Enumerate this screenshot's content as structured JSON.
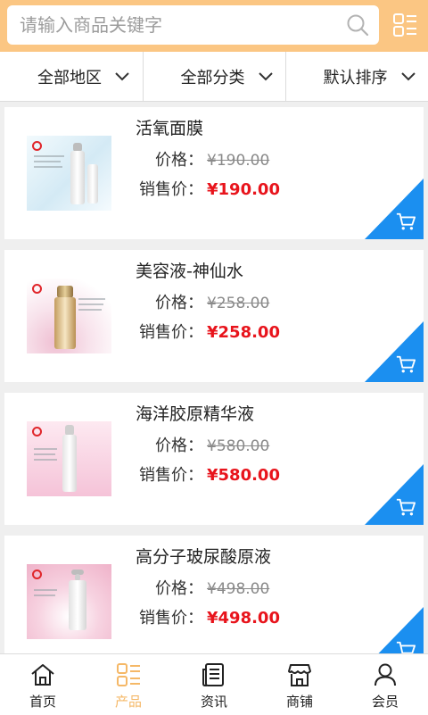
{
  "header": {
    "search_placeholder": "请输入商品关键字",
    "search_icon": "search-icon",
    "menu_icon": "grid-list-icon"
  },
  "filters": [
    {
      "label": "全部地区",
      "icon": "chevron-down-icon"
    },
    {
      "label": "全部分类",
      "icon": "chevron-down-icon"
    },
    {
      "label": "默认排序",
      "icon": "chevron-down-icon"
    }
  ],
  "products": [
    {
      "title": "活氧面膜",
      "price_label": "价格：",
      "price": "¥190.00",
      "sale_label": "销售价：",
      "sale_price": "¥190.00"
    },
    {
      "title": "美容液-神仙水",
      "price_label": "价格：",
      "price": "¥258.00",
      "sale_label": "销售价：",
      "sale_price": "¥258.00"
    },
    {
      "title": "海洋胶原精华液",
      "price_label": "价格：",
      "price": "¥580.00",
      "sale_label": "销售价：",
      "sale_price": "¥580.00"
    },
    {
      "title": "高分子玻尿酸原液",
      "price_label": "价格：",
      "price": "¥498.00",
      "sale_label": "销售价：",
      "sale_price": "¥498.00"
    }
  ],
  "product_action_icon": "cart-icon",
  "nav": [
    {
      "label": "首页",
      "icon": "home-icon",
      "active": false
    },
    {
      "label": "产品",
      "icon": "product-grid-icon",
      "active": true
    },
    {
      "label": "资讯",
      "icon": "news-icon",
      "active": false
    },
    {
      "label": "商铺",
      "icon": "shop-icon",
      "active": false
    },
    {
      "label": "会员",
      "icon": "user-icon",
      "active": false
    }
  ],
  "colors": {
    "header": "#fbc683",
    "active": "#f5b867",
    "cart_badge": "#1b8ff0",
    "sale_price": "#e8141c"
  }
}
